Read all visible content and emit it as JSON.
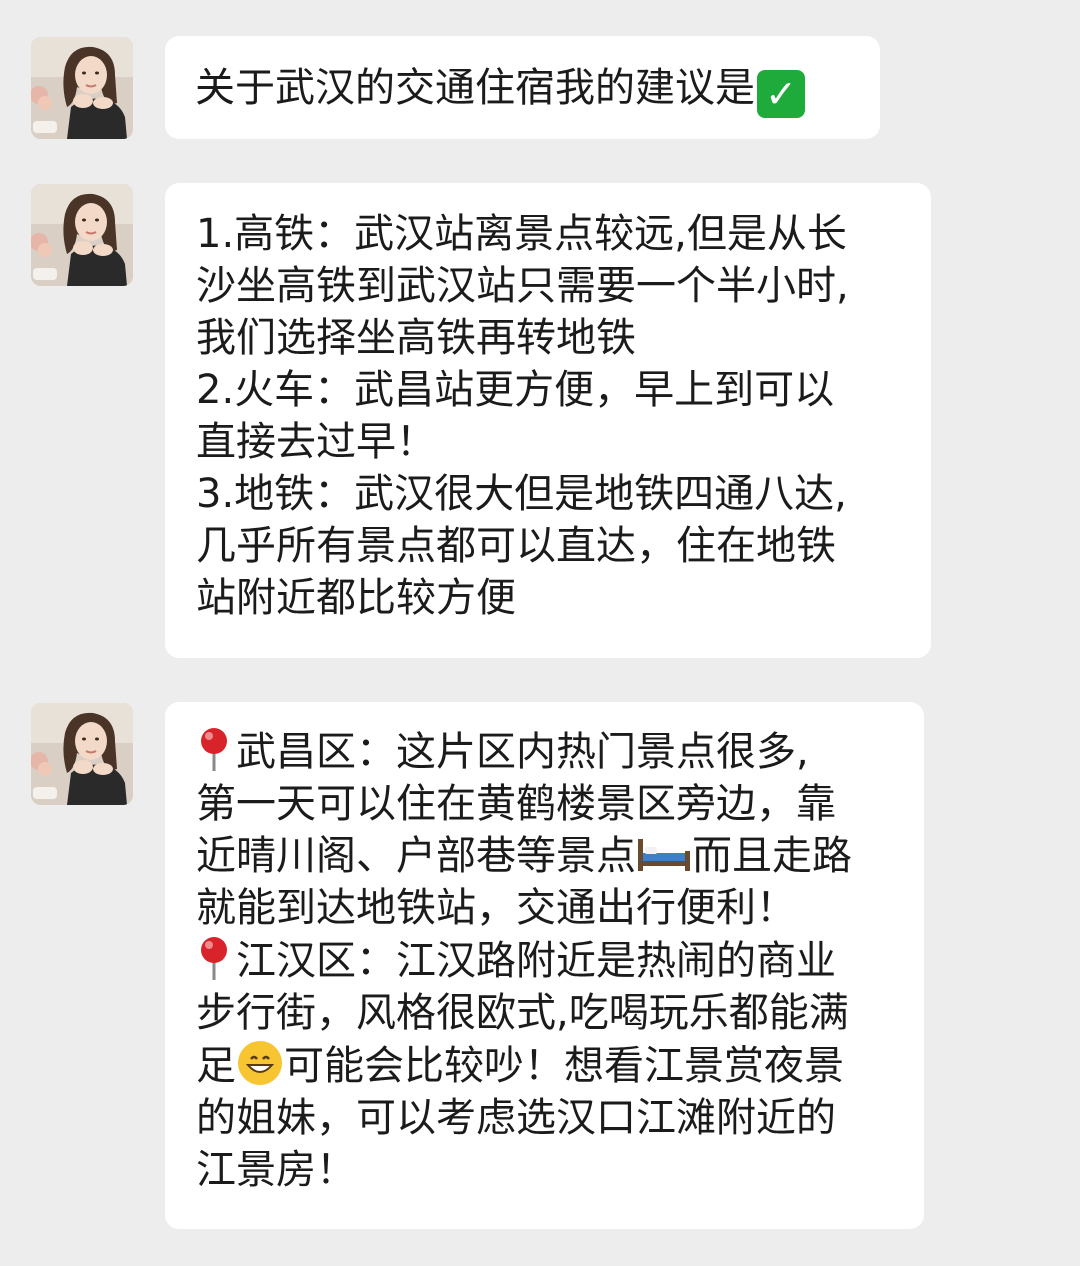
{
  "messages": [
    {
      "lines": [
        "关于武汉的交通住宿我的建议是"
      ],
      "trailing_emoji": "check-mark-button"
    },
    {
      "lines": [
        "1.高铁：武汉站离景点较远,但是从长",
        "沙坐高铁到武汉站只需要一个半小时,",
        "我们选择坐高铁再转地铁",
        "2.火车：武昌站更方便，早上到可以",
        "直接去过早！",
        "3.地铁：武汉很大但是地铁四通八达,",
        "几乎所有景点都可以直达，住在地铁",
        "站附近都比较方便"
      ]
    },
    {
      "segments": {
        "l1": "武昌区：这片区内热门景点很多,",
        "l2": "第一天可以住在黄鹤楼景区旁边，靠",
        "l3a": "近晴川阁、户部巷等景点",
        "l3b": "而且走路",
        "l4": "就能到达地铁站，交通出行便利！",
        "l5": "江汉区：江汉路附近是热闹的商业",
        "l6": "步行街，风格很欧式,吃喝玩乐都能满",
        "l7a": "足",
        "l7b": "可能会比较吵！想看江景赏夜景",
        "l8": "的姐妹，可以考虑选汉口江滩附近的",
        "l9": "江景房！"
      },
      "emojis": [
        "round-pushpin",
        "bed",
        "grinning-face"
      ]
    }
  ],
  "colors": {
    "background": "#ededed",
    "bubble": "#ffffff",
    "text": "#1b1b1b",
    "check": "#1faa3c",
    "pin": "#d8232a"
  }
}
